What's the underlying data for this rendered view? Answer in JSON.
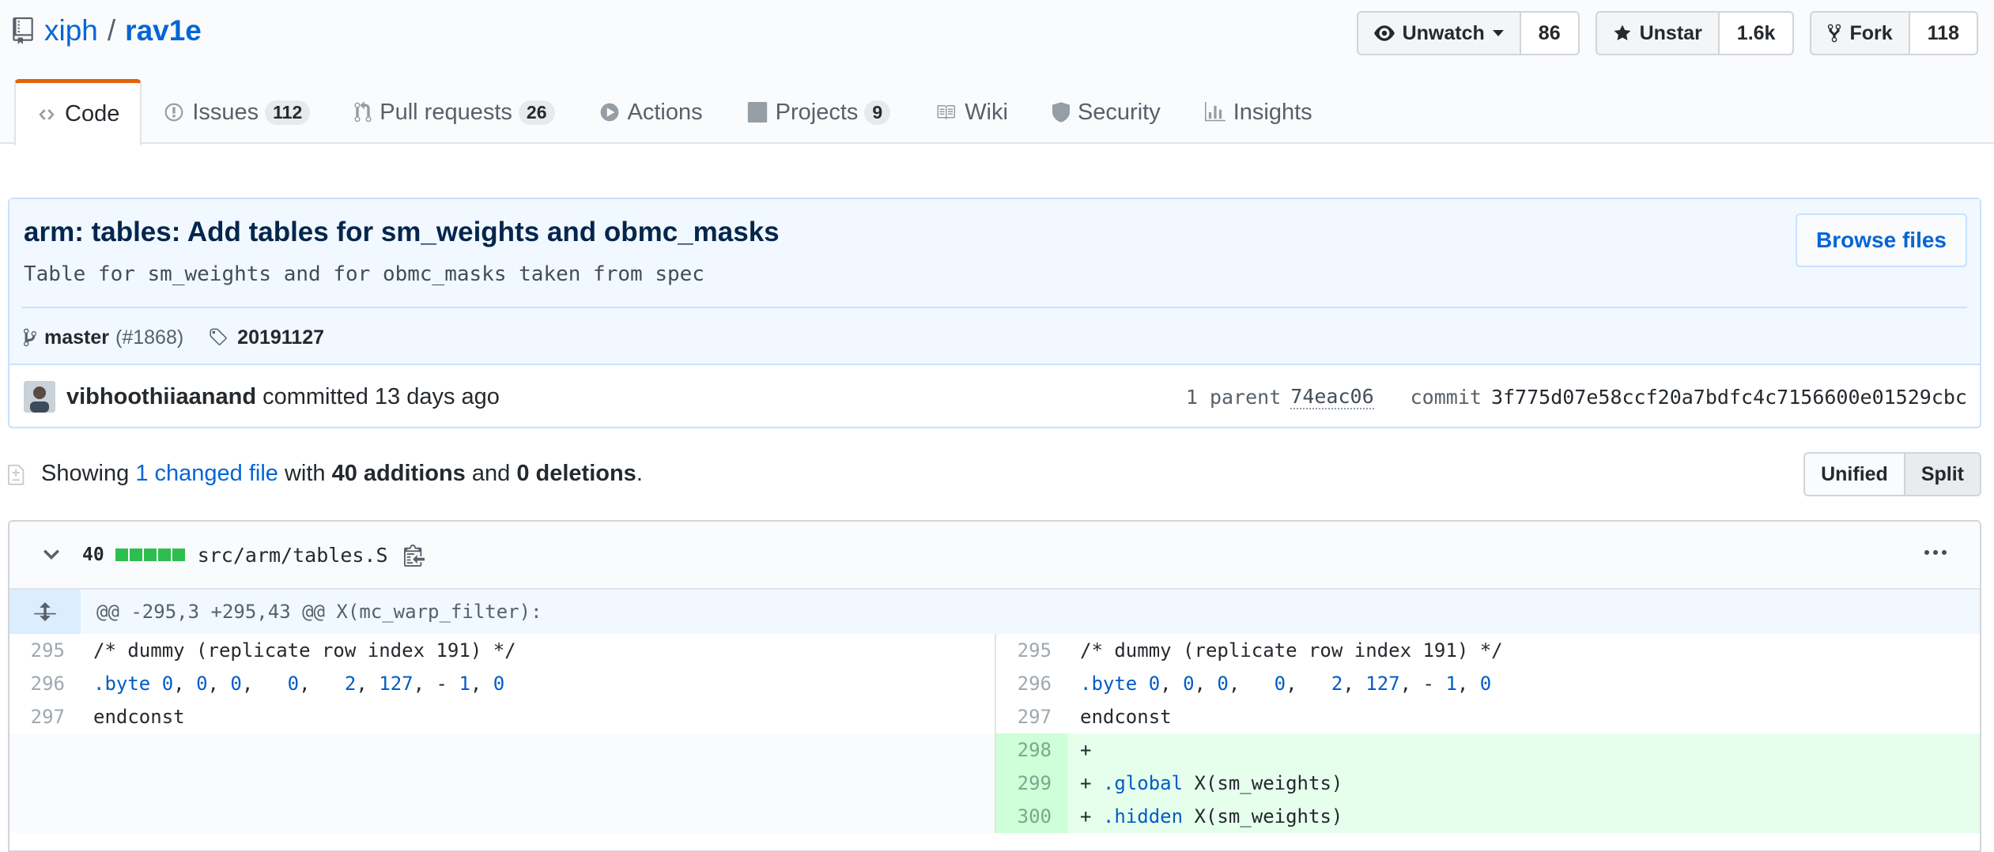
{
  "repo": {
    "owner": "xiph",
    "separator": "/",
    "name": "rav1e"
  },
  "actions": {
    "watch": {
      "label": "Unwatch",
      "count": "86"
    },
    "star": {
      "label": "Unstar",
      "count": "1.6k"
    },
    "fork": {
      "label": "Fork",
      "count": "118"
    }
  },
  "tabs": [
    {
      "label": "Code",
      "icon": "code-icon",
      "selected": true
    },
    {
      "label": "Issues",
      "icon": "issue-icon",
      "count": "112"
    },
    {
      "label": "Pull requests",
      "icon": "pull-request-icon",
      "count": "26"
    },
    {
      "label": "Actions",
      "icon": "play-icon"
    },
    {
      "label": "Projects",
      "icon": "project-icon",
      "count": "9"
    },
    {
      "label": "Wiki",
      "icon": "book-icon"
    },
    {
      "label": "Security",
      "icon": "shield-icon"
    },
    {
      "label": "Insights",
      "icon": "graph-icon"
    }
  ],
  "commit": {
    "title": "arm: tables: Add tables for sm_weights and obmc_masks",
    "description": "Table for sm_weights and for obmc_masks taken from spec",
    "browse_label": "Browse files",
    "branch": "master",
    "pr": "(#1868)",
    "tag": "20191127",
    "author": "vibhoothiiaanand",
    "committed_text": "committed 13 days ago",
    "parent_label": "1 parent",
    "parent_hash": "74eac06",
    "commit_label": "commit",
    "commit_hash": "3f775d07e58ccf20a7bdfc4c7156600e01529cbc"
  },
  "toc": {
    "showing": "Showing",
    "changed_files": "1 changed file",
    "with": "with",
    "additions": "40 additions",
    "and": "and",
    "deletions": "0 deletions",
    "period": ".",
    "view_unified": "Unified",
    "view_split": "Split",
    "selected_view": "Split"
  },
  "file": {
    "changes": "40",
    "path": "src/arm/tables.S",
    "hunk_header": "@@ -295,3 +295,43 @@ X(mc_warp_filter):"
  },
  "colors": {
    "accent": "#0366d6",
    "tab_active": "#e36209",
    "addition": "#2cbe4e",
    "addition_bg": "#e6ffed"
  },
  "left_lines": [
    {
      "num": "295",
      "text": "/* dummy (replicate row index 191) */"
    },
    {
      "num": "296",
      "text": ".byte 0, 0, 0,   0,   2, 127, - 1, 0"
    },
    {
      "num": "297",
      "text": "endconst"
    }
  ],
  "right_lines": [
    {
      "num": "295",
      "text": "/* dummy (replicate row index 191) */"
    },
    {
      "num": "296",
      "text": ".byte 0, 0, 0,   0,   2, 127, - 1, 0"
    },
    {
      "num": "297",
      "text": "endconst"
    },
    {
      "num": "298",
      "text": "+"
    },
    {
      "num": "299",
      "text": "+ .global X(sm_weights)"
    },
    {
      "num": "300",
      "text": "+ .hidden X(sm_weights)"
    }
  ]
}
